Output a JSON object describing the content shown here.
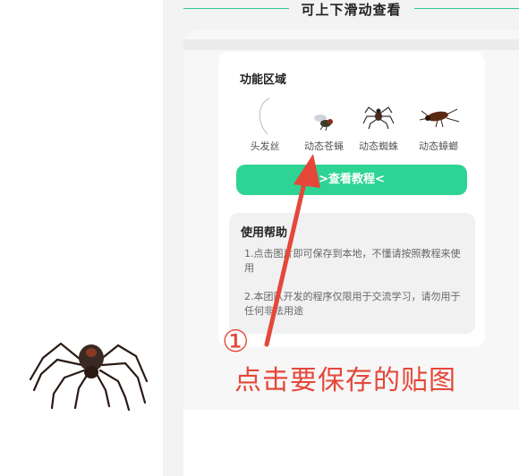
{
  "header": {
    "title": "可上下滑动查看"
  },
  "functions": {
    "title": "功能区域",
    "stickers": [
      {
        "label": "头发丝",
        "icon": "hair-icon"
      },
      {
        "label": "动态苍蝇",
        "icon": "fly-icon"
      },
      {
        "label": "动态蜘蛛",
        "icon": "spider-icon"
      },
      {
        "label": "动态蟑螂",
        "icon": "cockroach-icon"
      }
    ],
    "tutorial_button": ">查看教程<"
  },
  "help": {
    "title": "使用帮助",
    "item1": "1.点击图片即可保存到本地，不懂请按照教程来使用",
    "item2": "2.本团队开发的程序仅限用于交流学习，请勿用于任何非法用途"
  },
  "annotation": {
    "number": "①",
    "text": "点击要保存的贴图"
  },
  "colors": {
    "accent_green": "#2ed494",
    "annotation_red": "#e5473a"
  }
}
